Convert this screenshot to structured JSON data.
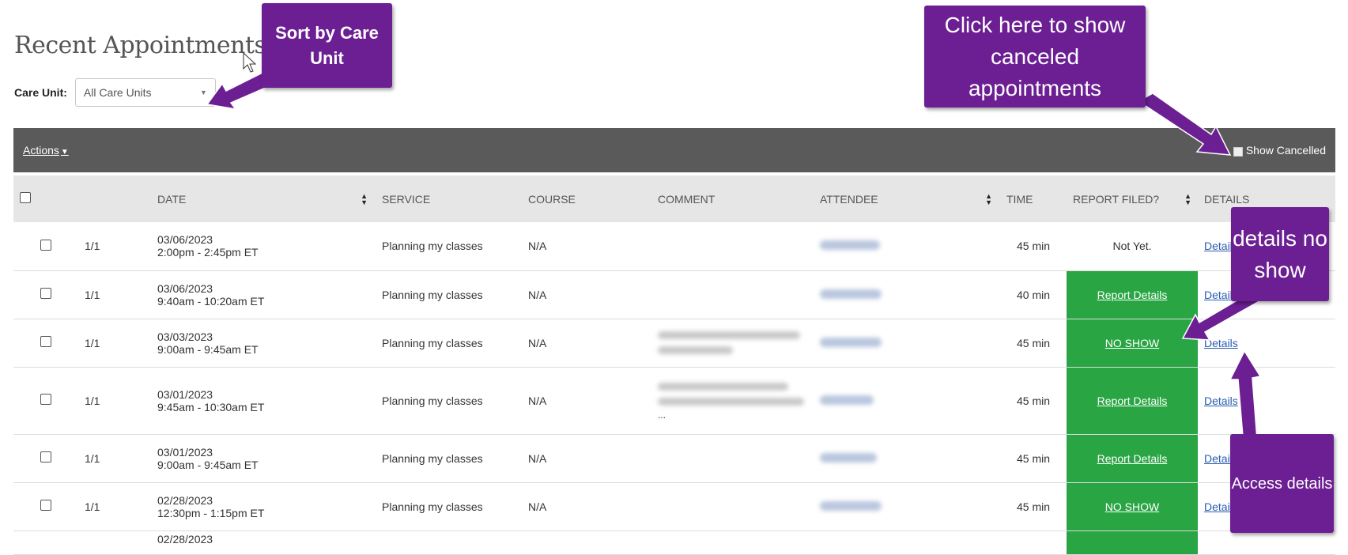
{
  "page": {
    "title": "Recent Appointments",
    "care_unit_label": "Care Unit:",
    "care_unit_value": "All Care Units"
  },
  "toolbar": {
    "actions_label": "Actions",
    "show_cancelled_label": "Show Cancelled"
  },
  "table": {
    "headers": {
      "date": "DATE",
      "service": "SERVICE",
      "course": "COURSE",
      "comment": "COMMENT",
      "attendee": "ATTENDEE",
      "time": "TIME",
      "report": "REPORT FILED?",
      "details": "DETAILS"
    },
    "rows": [
      {
        "count": "1/1",
        "date": "03/06/2023",
        "time_range": "2:00pm - 2:45pm ET",
        "service": "Planning my classes",
        "course": "N/A",
        "duration": "45 min",
        "report": "Not Yet.",
        "details": "Details"
      },
      {
        "count": "1/1",
        "date": "03/06/2023",
        "time_range": "9:40am - 10:20am ET",
        "service": "Planning my classes",
        "course": "N/A",
        "duration": "40 min",
        "report": "Report Details",
        "details": "Details"
      },
      {
        "count": "1/1",
        "date": "03/03/2023",
        "time_range": "9:00am - 9:45am ET",
        "service": "Planning my classes",
        "course": "N/A",
        "duration": "45 min",
        "report": "NO SHOW",
        "details": "Details"
      },
      {
        "count": "1/1",
        "date": "03/01/2023",
        "time_range": "9:45am - 10:30am ET",
        "service": "Planning my classes",
        "course": "N/A",
        "comment_ellipsis": "...",
        "duration": "45 min",
        "report": "Report Details",
        "details": "Details"
      },
      {
        "count": "1/1",
        "date": "03/01/2023",
        "time_range": "9:00am - 9:45am ET",
        "service": "Planning my classes",
        "course": "N/A",
        "duration": "45 min",
        "report": "Report Details",
        "details": "Details"
      },
      {
        "count": "1/1",
        "date": "02/28/2023",
        "time_range": "12:30pm - 1:15pm ET",
        "service": "Planning my classes",
        "course": "N/A",
        "duration": "45 min",
        "report": "NO SHOW",
        "details": "Details"
      },
      {
        "date": "02/28/2023"
      }
    ]
  },
  "callouts": {
    "sort": "Sort by Care Unit",
    "cancelled": "Click here to show canceled appointments",
    "noshow": "details no show",
    "access": "Access details"
  },
  "colors": {
    "callout_purple": "#6b1f93",
    "report_green": "#29a543",
    "toolbar_gray": "#5a5a5a"
  }
}
